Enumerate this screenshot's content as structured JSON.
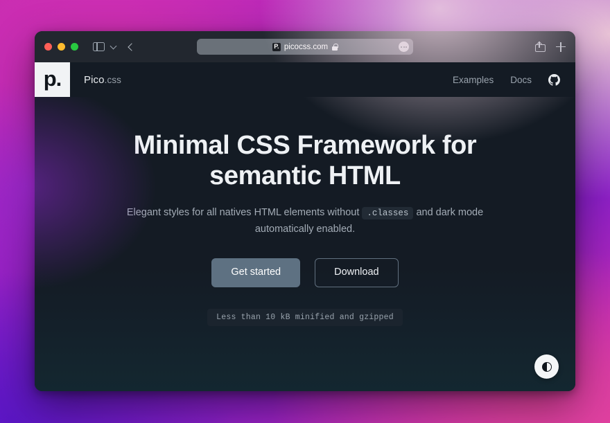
{
  "browser": {
    "traffic_lights": [
      {
        "name": "close",
        "color": "#ff5f57"
      },
      {
        "name": "minimize",
        "color": "#febc2e"
      },
      {
        "name": "maximize",
        "color": "#28c840"
      }
    ],
    "toolbar": {
      "sidebar_toggle_icon": "sidebar-icon",
      "tab_overview_icon": "chevron-down-icon",
      "back_icon": "back-arrow-icon",
      "share_icon": "share-icon",
      "new_tab_icon": "plus-icon"
    },
    "address_bar": {
      "favicon_label": "P.",
      "url": "picocss.com",
      "lock_icon": "lock-icon",
      "reader_icon": "page-settings-icon"
    }
  },
  "site": {
    "logo_mark": "p.",
    "brand_name": "Pico",
    "brand_ext": ".css",
    "nav": [
      {
        "label": "Examples"
      },
      {
        "label": "Docs"
      }
    ],
    "github_icon": "github-icon"
  },
  "hero": {
    "title": "Minimal CSS Framework for semantic HTML",
    "subtitle_before": "Elegant styles for all natives HTML elements without",
    "subtitle_code": ".classes",
    "subtitle_after": "and dark mode automatically enabled.",
    "primary_button": "Get started",
    "secondary_button": "Download",
    "badge": "Less than 10 kB minified and gzipped"
  },
  "theme_toggle": {
    "icon": "contrast-icon"
  },
  "colors": {
    "page_background": "#141b24",
    "toolbar": "#22272f",
    "accent_button": "#5e7182",
    "text_primary": "#eef1f4",
    "text_muted": "#9aa3ad",
    "wallpaper_magenta": "#c52bb0",
    "wallpaper_purple": "#7b1dcb",
    "wallpaper_pink": "#e03fa0"
  }
}
